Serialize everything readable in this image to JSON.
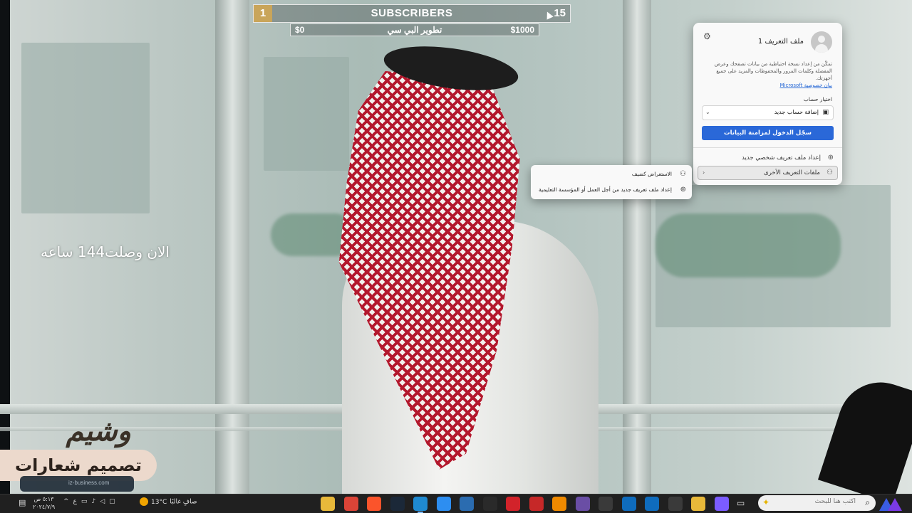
{
  "subscriber_widget": {
    "rank": "1",
    "title": "SUBSCRIBERS",
    "count": "15",
    "goal_min": "$0",
    "goal_name": "تطوير البي سي",
    "goal_max": "$1000"
  },
  "overlay": {
    "hours_text": "الان وصلت144 ساعه",
    "brand_logo": "وشيم",
    "brand_banner": "تصميم شعارات",
    "ghost_text": "iz-business.com"
  },
  "profile_panel": {
    "name": "ملف التعريف 1",
    "description": "تمكّن من إعداد نسخة احتياطية من بيانات تصفحك وعرض المفضلة وكلمات المرور والمحفوظات والمزيد على جميع أجهزتك.",
    "privacy_link": "بيان خصوصية Microsoft",
    "choose_account_label": "اختيار حساب",
    "account_select_value": "إضافة حساب جديد",
    "signin_button": "سجّل الدخول لمزامنة البيانات",
    "new_profile": "إعداد ملف تعريف شخصي جديد",
    "other_profiles": "ملفات التعريف الأخرى",
    "icons": {
      "settings": "gear-icon",
      "account": "person-card-icon",
      "add": "plus-circle-icon",
      "profiles": "people-icon"
    }
  },
  "sub_menu": {
    "guest": "الاستعراض كضيف",
    "work_profile": "إعداد ملف تعريف جديد من أجل العمل أو المؤسسة التعليمية"
  },
  "taskbar": {
    "search_placeholder": "اكتب هنا للبحث",
    "weather_desc": "صافٍ غالبًا",
    "temperature": "13°C",
    "clock_time": "٥:١٣ ص",
    "clock_date": "٢٠٢٤/٧/٩",
    "lang": "ع",
    "apps": [
      {
        "name": "file-explorer",
        "color": "#e8b93a"
      },
      {
        "name": "chrome",
        "color": "#db4437"
      },
      {
        "name": "brave",
        "color": "#fb542b"
      },
      {
        "name": "steam",
        "color": "#1b2838"
      },
      {
        "name": "edge",
        "color": "#1f8ad1"
      },
      {
        "name": "files",
        "color": "#2d8ef1"
      },
      {
        "name": "app-blue",
        "color": "#2b6cb0"
      },
      {
        "name": "epic-games",
        "color": "#2a2a2a"
      },
      {
        "name": "app-red",
        "color": "#d2232a"
      },
      {
        "name": "capture",
        "color": "#c62828"
      },
      {
        "name": "vlc",
        "color": "#f08a00"
      },
      {
        "name": "obs",
        "color": "#6a4ea5"
      },
      {
        "name": "github",
        "color": "#3a3a3a"
      },
      {
        "name": "mail",
        "color": "#0f6cbd"
      },
      {
        "name": "outlook",
        "color": "#0f6cbd"
      },
      {
        "name": "calculator",
        "color": "#3a3a3a"
      },
      {
        "name": "folder",
        "color": "#e8b93a"
      },
      {
        "name": "copilot",
        "color": "#7b5cff"
      }
    ]
  }
}
